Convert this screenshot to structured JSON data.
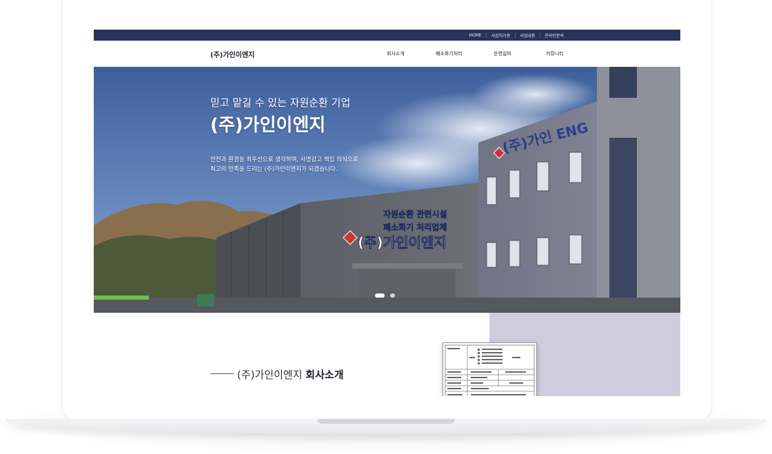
{
  "topbar": {
    "links": [
      "HOME",
      "사업허가증",
      "사업내용",
      "온라인문의"
    ],
    "separator": "|"
  },
  "header": {
    "logo": "(주)가인이엔지",
    "nav": [
      "회사소개",
      "폐소화기처리",
      "운영설비",
      "커뮤니티"
    ]
  },
  "hero": {
    "subtitle": "믿고 맡길 수 있는 자원순환 기업",
    "title": "(주)가인이엔지",
    "description_line1": "안전과 환경을 최우선으로 생각하며, 사명감고 책임 의식으로",
    "description_line2": "최고의 만족을 드리는 (주)가인이엔지가 되겠습니다.",
    "building_sign_1": "(주)가인 ENG",
    "building_sign_2": "자원순환 관련시설",
    "building_sign_3": "폐소화기 처리업체",
    "building_sign_4": "(주)가인이엔지",
    "slider": {
      "total": 2,
      "active": 1
    }
  },
  "intro": {
    "title_prefix": "(주)가인이엔지",
    "title_bold": "회사소개"
  },
  "colors": {
    "topbar": "#27335a",
    "panel": "#cfcddd",
    "sky": "#4d6fa8"
  }
}
